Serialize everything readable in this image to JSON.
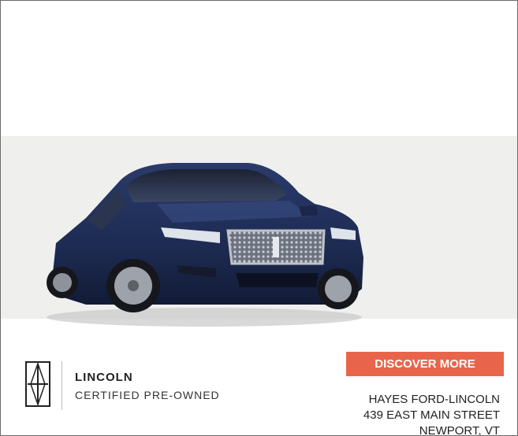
{
  "ad": {
    "brand": "LINCOLN",
    "program": "CERTIFIED PRE-OWNED",
    "cta_label": "DISCOVER MORE",
    "dealer": {
      "name": "HAYES FORD-LINCOLN",
      "street": "439 EAST MAIN STREET",
      "city": "NEWPORT, VT"
    },
    "colors": {
      "cta": "#e8654b",
      "band": "#efefed",
      "car_body": "#1e2d55"
    },
    "icons": [
      "lincoln-star-logo-icon"
    ],
    "image": "car-image"
  }
}
